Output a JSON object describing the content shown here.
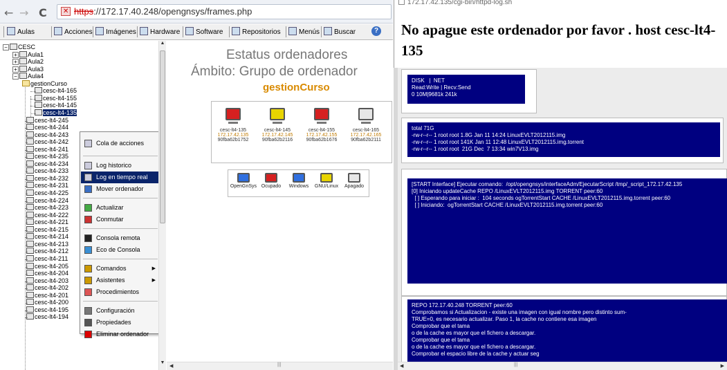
{
  "browser": {
    "url_scheme": "https",
    "url_rest": "://172.17.40.248/opengnsys/frames.php",
    "back_icon": "back-arrow-icon",
    "forward_icon": "forward-arrow-icon",
    "reload_icon": "reload-icon"
  },
  "toolbar": {
    "items": [
      {
        "label": "Aulas",
        "icon": "classroom-icon"
      },
      {
        "label": "Acciones",
        "icon": "actions-icon"
      },
      {
        "label": "Imágenes",
        "icon": "images-icon"
      },
      {
        "label": "Hardware",
        "icon": "hardware-icon"
      },
      {
        "label": "Software",
        "icon": "software-icon"
      },
      {
        "label": "Repositorios",
        "icon": "repository-icon"
      },
      {
        "label": "Menús",
        "icon": "menu-icon"
      },
      {
        "label": "Buscar",
        "icon": "search-icon"
      }
    ]
  },
  "tree": {
    "root": "CESC",
    "classrooms": [
      "Aula1",
      "Aula2",
      "Aula3",
      "Aula4"
    ],
    "group": "gestionCurso",
    "group_hosts": [
      "cesc-lt4-165",
      "cesc-lt4-155",
      "cesc-lt4-145",
      "cesc-lt4-135"
    ],
    "hosts": [
      "cesc-lt4-245",
      "cesc-lt4-244",
      "cesc-lt4-243",
      "cesc-lt4-242",
      "cesc-lt4-241",
      "cesc-lt4-235",
      "cesc-lt4-234",
      "cesc-lt4-233",
      "cesc-lt4-232",
      "cesc-lt4-231",
      "cesc-lt4-225",
      "cesc-lt4-224",
      "cesc-lt4-223",
      "cesc-lt4-222",
      "cesc-lt4-221",
      "cesc-lt4-215",
      "cesc-lt4-214",
      "cesc-lt4-213",
      "cesc-lt4-212",
      "cesc-lt4-211",
      "cesc-lt4-205",
      "cesc-lt4-204",
      "cesc-lt4-203",
      "cesc-lt4-202",
      "cesc-lt4-201",
      "cesc-lt4-200",
      "cesc-lt4-195",
      "cesc-lt4-194"
    ]
  },
  "context_menu": {
    "groups": [
      [
        {
          "label": "Cola de acciones"
        }
      ],
      [
        {
          "label": "Log historico"
        },
        {
          "label": "Log en tiempo real",
          "highlighted": true
        },
        {
          "label": "Mover ordenador"
        }
      ],
      [
        {
          "label": "Actualizar"
        },
        {
          "label": "Conmutar"
        }
      ],
      [
        {
          "label": "Consola remota"
        },
        {
          "label": "Eco de Consola"
        }
      ],
      [
        {
          "label": "Comandos",
          "submenu": true
        },
        {
          "label": "Asistentes",
          "submenu": true
        },
        {
          "label": "Procedimientos"
        }
      ],
      [
        {
          "label": "Configuración"
        },
        {
          "label": "Propiedades"
        },
        {
          "label": "Eliminar ordenador"
        }
      ]
    ]
  },
  "status_panel": {
    "title_line1": "Estatus ordenadores",
    "title_line2": "Ámbito: Grupo de ordenador",
    "group_name": "gestionCurso",
    "computers": [
      {
        "name": "cesc-lt4-135",
        "ip": "172.17.42.135",
        "mac": "90fba62b1752",
        "color": "#d62020"
      },
      {
        "name": "cesc-lt4-145",
        "ip": "172.17.42.145",
        "mac": "90fba62b2116",
        "color": "#e8d400"
      },
      {
        "name": "cesc-lt4-155",
        "ip": "172.17.42.155",
        "mac": "90fba62b1676",
        "color": "#d62020"
      },
      {
        "name": "cesc-lt4-165",
        "ip": "172.17.42.165",
        "mac": "90fba62b2111",
        "color": "#e6e6e6"
      }
    ],
    "legend": [
      {
        "label": "OpenGnSys",
        "color": "#2f6fe0"
      },
      {
        "label": "Ocupado",
        "color": "#d62020"
      },
      {
        "label": "Windows",
        "color": "#2f6fe0"
      },
      {
        "label": "GNU/Linux",
        "color": "#e8d400"
      },
      {
        "label": "Apagado",
        "color": "#e6e6e6"
      }
    ]
  },
  "log_window": {
    "url": "172.17.42.135/cgi-bin/httpd-log.sh",
    "heading": "No apague este ordenador por favor . host cesc-lt4-135",
    "disk_net": "DISK   |  NET\nRead:Write | Recv:Send\n0 10M|9681k 241k",
    "listing": "total 71G\n-rw-r--r-- 1 root root 1.8G Jan 11 14:24 LinuxEVLT2012115.img\n-rw-r--r-- 1 root root 141K Jan 11 12:48 LinuxEVLT2012115.img.torrent\n-rw-r--r-- 1 root root  21G Dec  7 13:34 win7V13.img",
    "interface_log": "[START Interface] Ejecutar comando:  /opt/opengnsys/interfaceAdm/EjecutarScript /tmp/_script_172.17.42.135\n[0] Iniciando updateCache REPO /LinuxEVLT2012115.img TORRENT peer:60\n  [ ] Esperando para iniciar :  104 seconds ogTorrentStart CACHE /LinuxEVLT2012115.img.torrent peer:60\n  [ ] Iniciando:  ogTorrentStart CACHE /LinuxEVLT2012115.img.torrent peer:60",
    "session_log": "REPO 172.17.40.248 TORRENT peer:60\nComprobamos si Actualizacion - existe una imagen con igual nombre pero distinto sum-\nTRUE=0, es necesario actualizar. Paso 1, la cache no contiene esa imagen\nComprobar que el tama\no de la cache es mayor que el fichero a descargar.\nComprobar que el tama\no de la cache es mayor que el fichero a descargar.\nComprobar el espacio libre de la cache y actuar seg"
  }
}
